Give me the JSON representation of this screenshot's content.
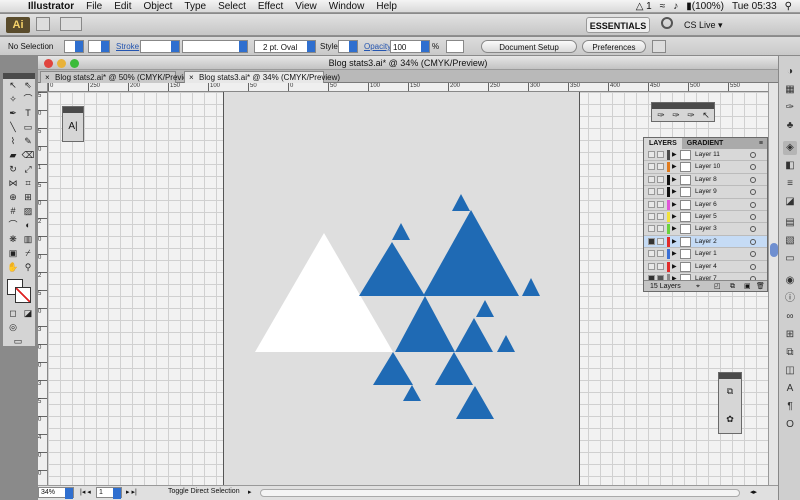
{
  "menubar": {
    "app": "Illustrator",
    "items": [
      "File",
      "Edit",
      "Object",
      "Type",
      "Select",
      "Effect",
      "View",
      "Window",
      "Help"
    ],
    "battery": "(100%)",
    "clock": "Tue 05:33",
    "adobe_badge": "1"
  },
  "appbar": {
    "logo": "Ai",
    "workspace": "ESSENTIALS ▾",
    "cs_live": "CS Live ▾"
  },
  "controlbar": {
    "selection": "No Selection",
    "stroke_label": "Stroke",
    "brush": "2 pt. Oval",
    "style_label": "Style",
    "opacity_label": "Opacity",
    "opacity_value": "100",
    "opacity_unit": "%",
    "doc_setup": "Document Setup",
    "preferences": "Preferences"
  },
  "document": {
    "title": "Blog stats3.ai* @ 34% (CMYK/Preview)",
    "tabs": [
      {
        "label": "Blog stats2.ai* @ 50% (CMYK/Preview)",
        "active": false
      },
      {
        "label": "Blog stats3.ai* @ 34% (CMYK/Preview)",
        "active": true
      }
    ]
  },
  "rulers": {
    "h": [
      "0",
      "250",
      "200",
      "150",
      "100",
      "50",
      "0",
      "50",
      "100",
      "150",
      "200",
      "250",
      "300",
      "350",
      "400",
      "450",
      "500",
      "550",
      "600"
    ],
    "v": [
      "5",
      "0",
      "5",
      "0",
      "1",
      "5",
      "0",
      "2",
      "0",
      "0",
      "2",
      "5",
      "0",
      "3",
      "0",
      "0",
      "3",
      "5",
      "0",
      "4",
      "0",
      "0"
    ]
  },
  "statusbar": {
    "zoom": "34%",
    "artboard": "1",
    "status": "Toggle Direct Selection"
  },
  "layers_panel": {
    "tabs": [
      "LAYERS",
      "GRADIENT"
    ],
    "footer": "15 Layers",
    "rows": [
      {
        "name": "Layer 11",
        "color": "#4a4a4a",
        "selected": false,
        "eye": false,
        "lock": false
      },
      {
        "name": "Layer 10",
        "color": "#e07b1e",
        "selected": false,
        "eye": false,
        "lock": false
      },
      {
        "name": "Layer 8",
        "color": "#111111",
        "selected": false,
        "eye": false,
        "lock": false
      },
      {
        "name": "Layer 9",
        "color": "#111111",
        "selected": false,
        "eye": false,
        "lock": false
      },
      {
        "name": "Layer 6",
        "color": "#e055d8",
        "selected": false,
        "eye": false,
        "lock": false
      },
      {
        "name": "Layer 5",
        "color": "#f2e33a",
        "selected": false,
        "eye": false,
        "lock": false
      },
      {
        "name": "Layer 3",
        "color": "#6bd23e",
        "selected": false,
        "eye": false,
        "lock": false
      },
      {
        "name": "Layer 2",
        "color": "#e12b2b",
        "selected": true,
        "eye": true,
        "lock": false
      },
      {
        "name": "Layer 1",
        "color": "#3a6fd6",
        "selected": false,
        "eye": false,
        "lock": false
      },
      {
        "name": "Layer 4",
        "color": "#e12b2b",
        "selected": false,
        "eye": false,
        "lock": false
      },
      {
        "name": "Layer 7",
        "color": "#8a8a8a",
        "selected": false,
        "eye": true,
        "lock": true
      }
    ]
  },
  "colors": {
    "triangle_blue": "#1f6ab4",
    "triangle_white": "#ffffff",
    "artboard": "#dedede",
    "selected_row": "#c5dbf5"
  }
}
